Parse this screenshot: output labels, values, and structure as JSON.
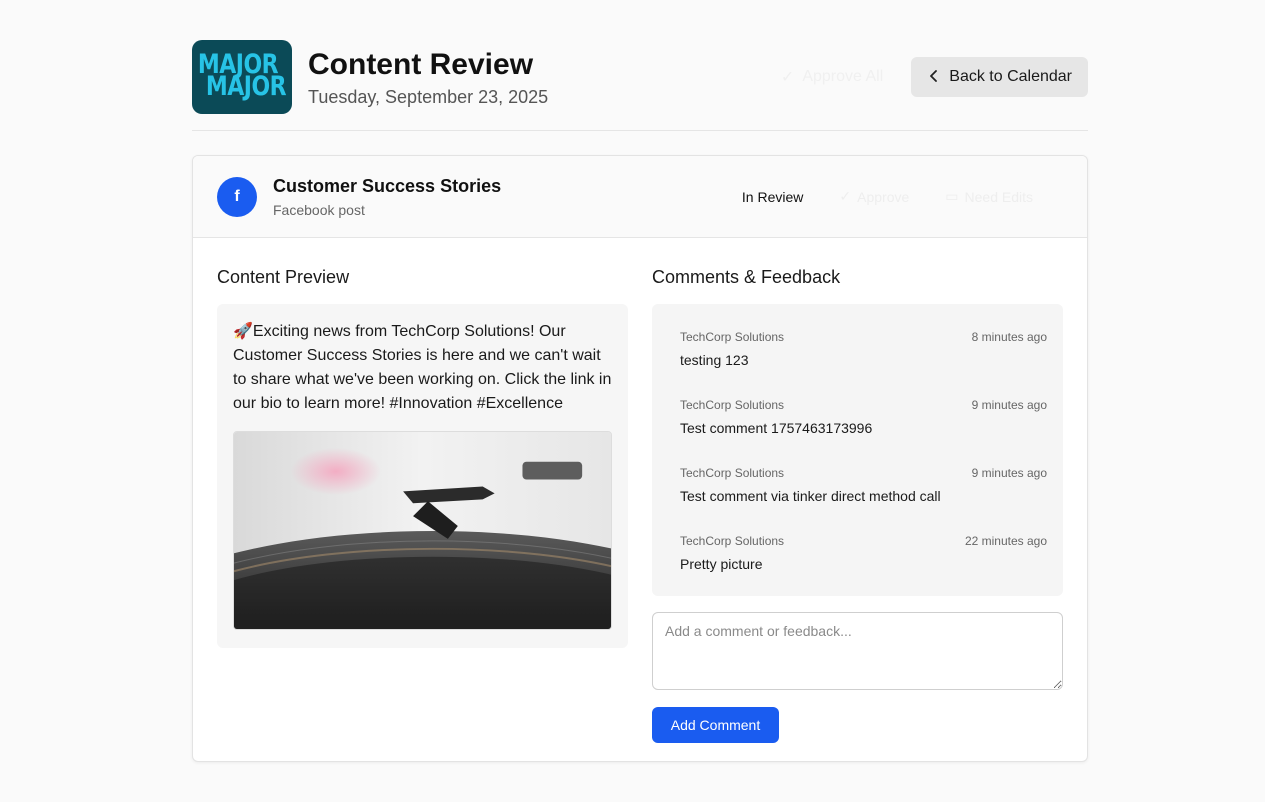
{
  "header": {
    "logo_text_1": "MAJOR",
    "logo_text_2": "MAJOR",
    "title": "Content Review",
    "date": "Tuesday, September 23, 2025",
    "approve_all_label": "Approve All",
    "back_label": "Back to Calendar"
  },
  "post": {
    "avatar_letter": "f",
    "title": "Customer Success Stories",
    "subtitle": "Facebook post",
    "status": "In Review",
    "approve_label": "Approve",
    "needs_edits_label": "Need Edits"
  },
  "preview": {
    "heading": "Content Preview",
    "text": "🚀Exciting news from TechCorp Solutions! Our Customer Success Stories is here and we can't wait to share what we've been working on. Click the link in our bio to learn more! #Innovation #Excellence"
  },
  "comments": {
    "heading": "Comments & Feedback",
    "items": [
      {
        "author": "TechCorp Solutions",
        "time": "8 minutes ago",
        "text": "testing 123"
      },
      {
        "author": "TechCorp Solutions",
        "time": "9 minutes ago",
        "text": "Test comment 1757463173996"
      },
      {
        "author": "TechCorp Solutions",
        "time": "9 minutes ago",
        "text": "Test comment via tinker direct method call"
      },
      {
        "author": "TechCorp Solutions",
        "time": "22 minutes ago",
        "text": "Pretty picture"
      }
    ],
    "input_placeholder": "Add a comment or feedback...",
    "input_value": "",
    "submit_label": "Add Comment"
  },
  "colors": {
    "accent": "#1a5cf0",
    "logo_bg": "#0b4a57",
    "logo_text": "#27c3e6"
  }
}
